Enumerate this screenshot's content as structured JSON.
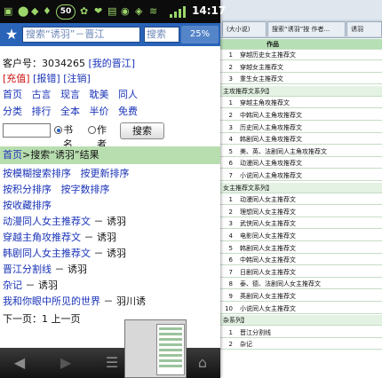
{
  "status_bar": {
    "battery": "50",
    "time": "14:17"
  },
  "browser": {
    "url_text": "搜索“诱羽”－晋江",
    "search_box_text": "搜索",
    "tab_count": "25%"
  },
  "page": {
    "customer_line": {
      "label": "客户号：3034265",
      "link": "[我的晋江]"
    },
    "account_links": [
      "[充值]",
      "[报错]",
      "[注销]"
    ],
    "nav_row1": [
      "首页",
      "古言",
      "现言",
      "耽美",
      "同人"
    ],
    "nav_row2": [
      "分类",
      "排行",
      "全本",
      "半价",
      "免费"
    ],
    "search": {
      "option_title": "书名",
      "option_author": "作者",
      "button": "搜索"
    },
    "result_header": {
      "home": "首页",
      "rest": ">搜索“诱羽”结果"
    },
    "sort_row1": [
      "按模糊搜索排序",
      "按更新排序"
    ],
    "sort_row2": [
      "按积分排序",
      "按字数排序"
    ],
    "sort_row3": "按收藏排序",
    "results": [
      {
        "title": "动漫同人女主推荐文",
        "author": " － 诱羽"
      },
      {
        "title": "穿越主角攻推荐文",
        "author": " － 诱羽"
      },
      {
        "title": "韩剧同人女主推荐文",
        "author": " － 诱羽"
      },
      {
        "title": "晋江分割线",
        "author": " － 诱羽"
      },
      {
        "title": "杂记",
        "author": " － 诱羽"
      },
      {
        "title": "我和你眼中所见的世界",
        "author": " － 羽川诱"
      }
    ],
    "pager": "下一页：1  上一页"
  },
  "background_window": {
    "tabs": [
      "(大小说)",
      "搜索“诱羽”按 作者...",
      "诱羽"
    ],
    "table_header": "作品",
    "rows": [
      {
        "num": "1",
        "text": "穿越历史女主推荐文",
        "cat": false
      },
      {
        "num": "2",
        "text": "穿越女主推荐文",
        "cat": false
      },
      {
        "num": "3",
        "text": "重生女主推荐文",
        "cat": false
      },
      {
        "num": "",
        "text": "主攻推荐文系列】",
        "cat": true
      },
      {
        "num": "1",
        "text": "穿越主角攻推荐文",
        "cat": false
      },
      {
        "num": "2",
        "text": "中韩同人主角攻推荐文",
        "cat": false
      },
      {
        "num": "3",
        "text": "历史同人主角攻推荐文",
        "cat": false
      },
      {
        "num": "4",
        "text": "韩剧同人主角攻推荐文",
        "cat": false
      },
      {
        "num": "5",
        "text": "美、英、法剧同人主角攻推荐文",
        "cat": false
      },
      {
        "num": "6",
        "text": "动漫同人主角攻推荐文",
        "cat": false
      },
      {
        "num": "7",
        "text": "小说同人主角攻推荐文",
        "cat": false
      },
      {
        "num": "",
        "text": "女主推荐文系列】",
        "cat": true
      },
      {
        "num": "1",
        "text": "动漫同人女主推荐文",
        "cat": false
      },
      {
        "num": "2",
        "text": "理想同人女主推荐文",
        "cat": false
      },
      {
        "num": "3",
        "text": "武侠同人女主推荐文",
        "cat": false
      },
      {
        "num": "4",
        "text": "电影同人女主推荐文",
        "cat": false
      },
      {
        "num": "5",
        "text": "韩剧同人女主推荐文",
        "cat": false
      },
      {
        "num": "6",
        "text": "中韩同人女主推荐文",
        "cat": false
      },
      {
        "num": "7",
        "text": "日剧同人女主推荐文",
        "cat": false
      },
      {
        "num": "8",
        "text": "泰、德、法剧同人女主推荐文",
        "cat": false
      },
      {
        "num": "9",
        "text": "英剧同人女主推荐文",
        "cat": false
      },
      {
        "num": "10",
        "text": "小说同人女主推荐文",
        "cat": false
      },
      {
        "num": "",
        "text": "杂系列】",
        "cat": true
      },
      {
        "num": "1",
        "text": "晋江分割线",
        "cat": false
      },
      {
        "num": "2",
        "text": "杂记",
        "cat": false
      }
    ]
  },
  "colors": {
    "link": "#1a33b8",
    "red_link": "#cc1111",
    "result_bar": "#b8deb0",
    "url_bar": "#2a64b8"
  },
  "icons": [
    "star-icon",
    "back-icon",
    "forward-icon",
    "menu-icon",
    "home-icon",
    "signal-icon",
    "battery-icon"
  ]
}
